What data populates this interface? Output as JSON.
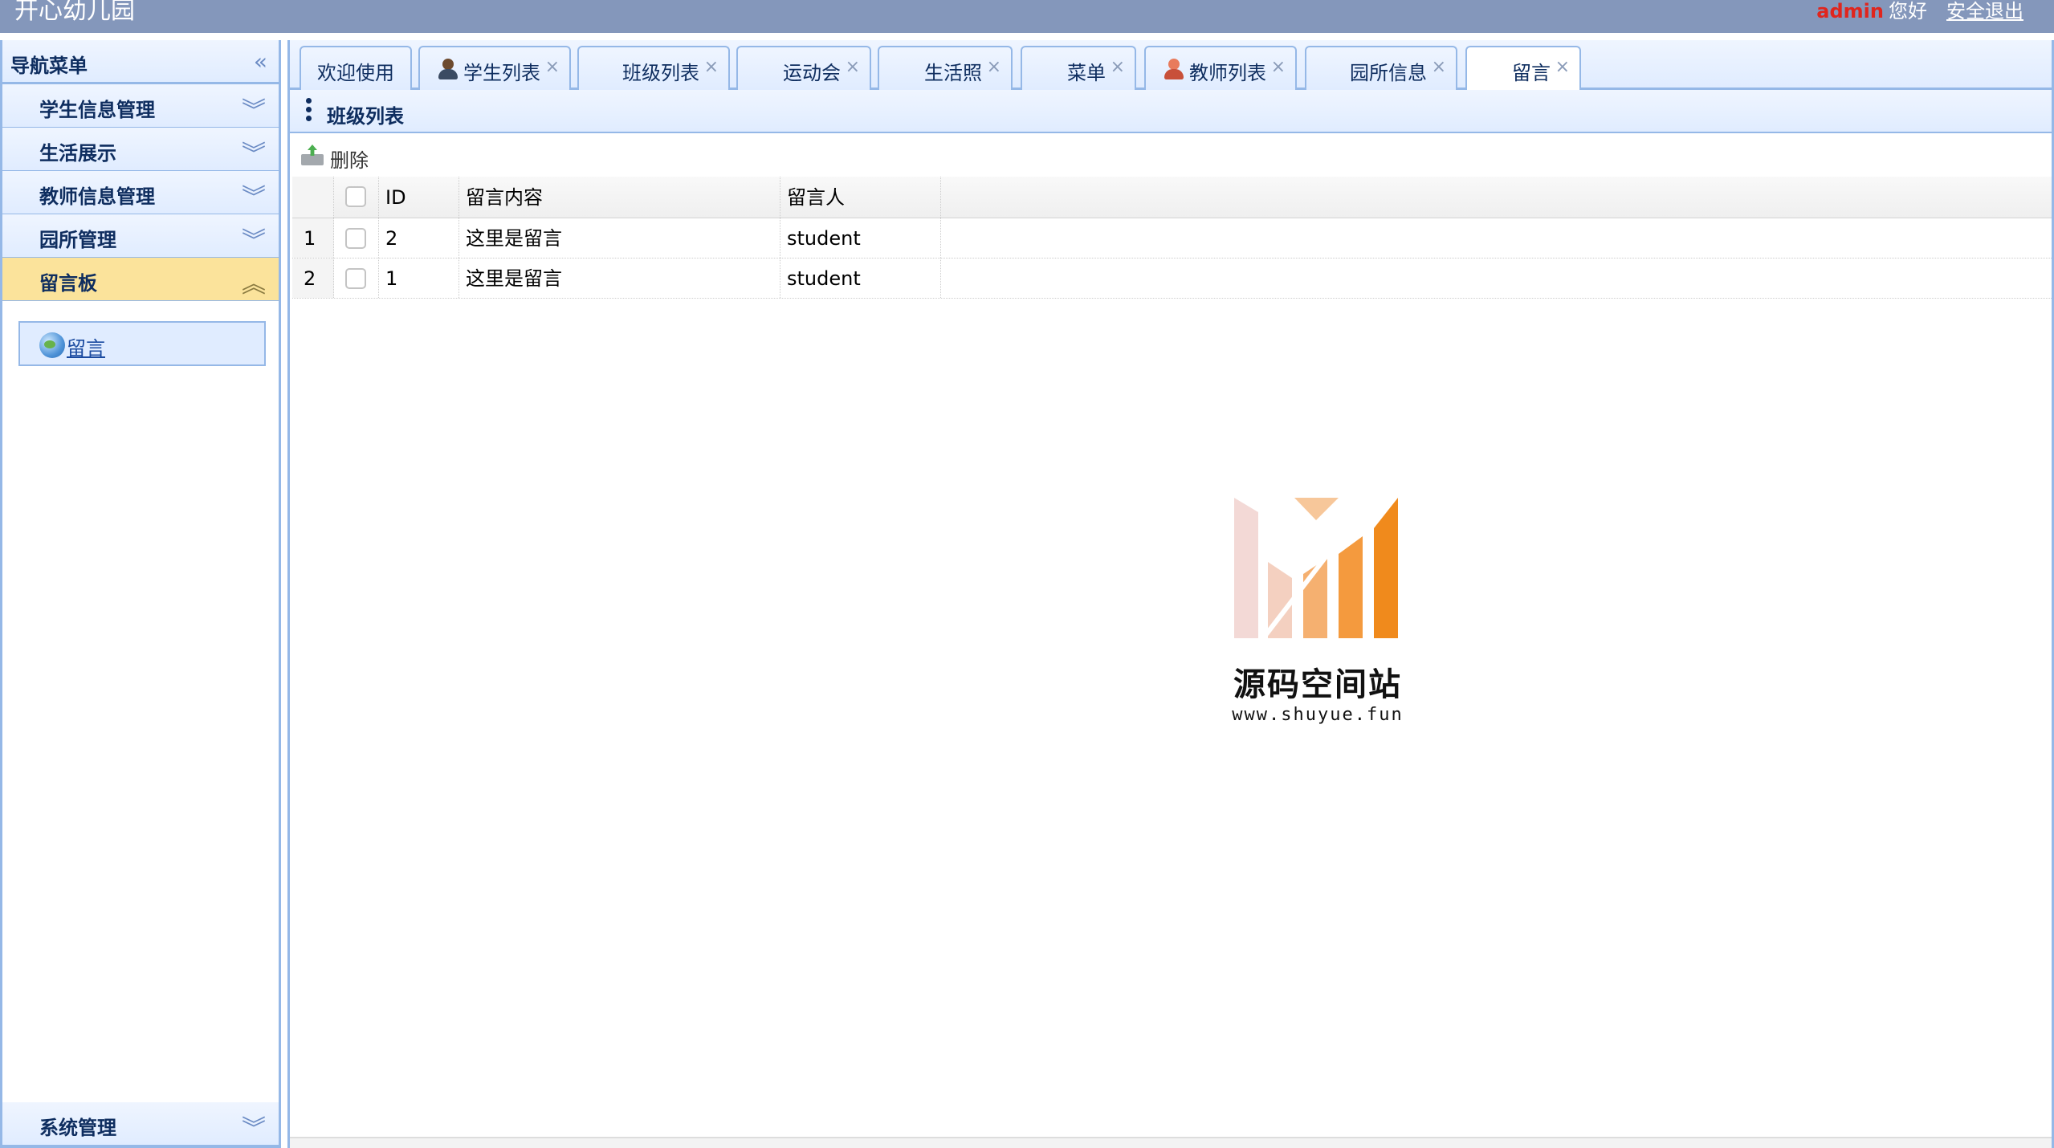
{
  "header": {
    "app_title": "开心幼儿园",
    "user": "admin",
    "greeting": "您好",
    "logout": "安全退出",
    "background": "#8497bb"
  },
  "sidebar": {
    "title": "导航菜单",
    "items": [
      {
        "label": "学生信息管理"
      },
      {
        "label": "生活展示"
      },
      {
        "label": "教师信息管理"
      },
      {
        "label": "园所管理"
      },
      {
        "label": "留言板"
      }
    ],
    "active_submenu": {
      "label": "留言"
    },
    "bottom_item": {
      "label": "系统管理"
    }
  },
  "tabs": [
    {
      "label": "欢迎使用",
      "closable": false
    },
    {
      "label": "学生列表",
      "icon": "student-icon"
    },
    {
      "label": "班级列表"
    },
    {
      "label": "运动会"
    },
    {
      "label": "生活照"
    },
    {
      "label": "菜单"
    },
    {
      "label": "教师列表",
      "icon": "teacher-icon"
    },
    {
      "label": "园所信息"
    },
    {
      "label": "留言",
      "active": true
    }
  ],
  "tab_close_glyph": "×",
  "panel": {
    "title": "班级列表",
    "toolbar": {
      "delete_label": "删除"
    }
  },
  "grid": {
    "columns": [
      "ID",
      "留言内容",
      "留言人"
    ],
    "rows": [
      {
        "num": "1",
        "id": "2",
        "content": "这里是留言",
        "author": "student"
      },
      {
        "num": "2",
        "id": "1",
        "content": "这里是留言",
        "author": "student"
      }
    ]
  },
  "watermark": {
    "title": "源码空间站",
    "url": "www.shuyue.fun"
  },
  "colors": {
    "accent_border": "#95b8e7",
    "active_menu": "#fbe39b",
    "user_name": "#e0251d",
    "watermark_orange": "#f08a1c"
  }
}
